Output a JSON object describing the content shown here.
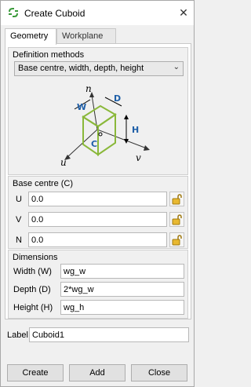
{
  "window": {
    "title": "Create Cuboid"
  },
  "tabs": [
    {
      "label": "Geometry",
      "active": true
    },
    {
      "label": "Workplane",
      "active": false
    }
  ],
  "definition": {
    "group_title": "Definition methods",
    "method": "Base centre, width, depth, height",
    "diagram_labels": {
      "n": "n",
      "u": "u",
      "v": "v",
      "w": "W",
      "d": "D",
      "h": "H",
      "c": "C"
    }
  },
  "base_centre": {
    "group_title": "Base centre (C)",
    "rows": [
      {
        "label": "U",
        "value": "0.0"
      },
      {
        "label": "V",
        "value": "0.0"
      },
      {
        "label": "N",
        "value": "0.0"
      }
    ]
  },
  "dimensions": {
    "group_title": "Dimensions",
    "rows": [
      {
        "label": "Width (W)",
        "value": "wg_w"
      },
      {
        "label": "Depth (D)",
        "value": "2*wg_w"
      },
      {
        "label": "Height (H)",
        "value": "wg_h"
      }
    ]
  },
  "label": {
    "caption": "Label",
    "value": "Cuboid1"
  },
  "buttons": {
    "create": "Create",
    "add": "Add",
    "close": "Close"
  },
  "colors": {
    "accent_green": "#3a9a3a",
    "cuboid": "#8ab83a",
    "dim_blue": "#1f5fa8"
  },
  "icons": {
    "title": "app-logo-icon",
    "lock": "unlocked-padlock-icon",
    "combo": "chevron-down-icon"
  }
}
